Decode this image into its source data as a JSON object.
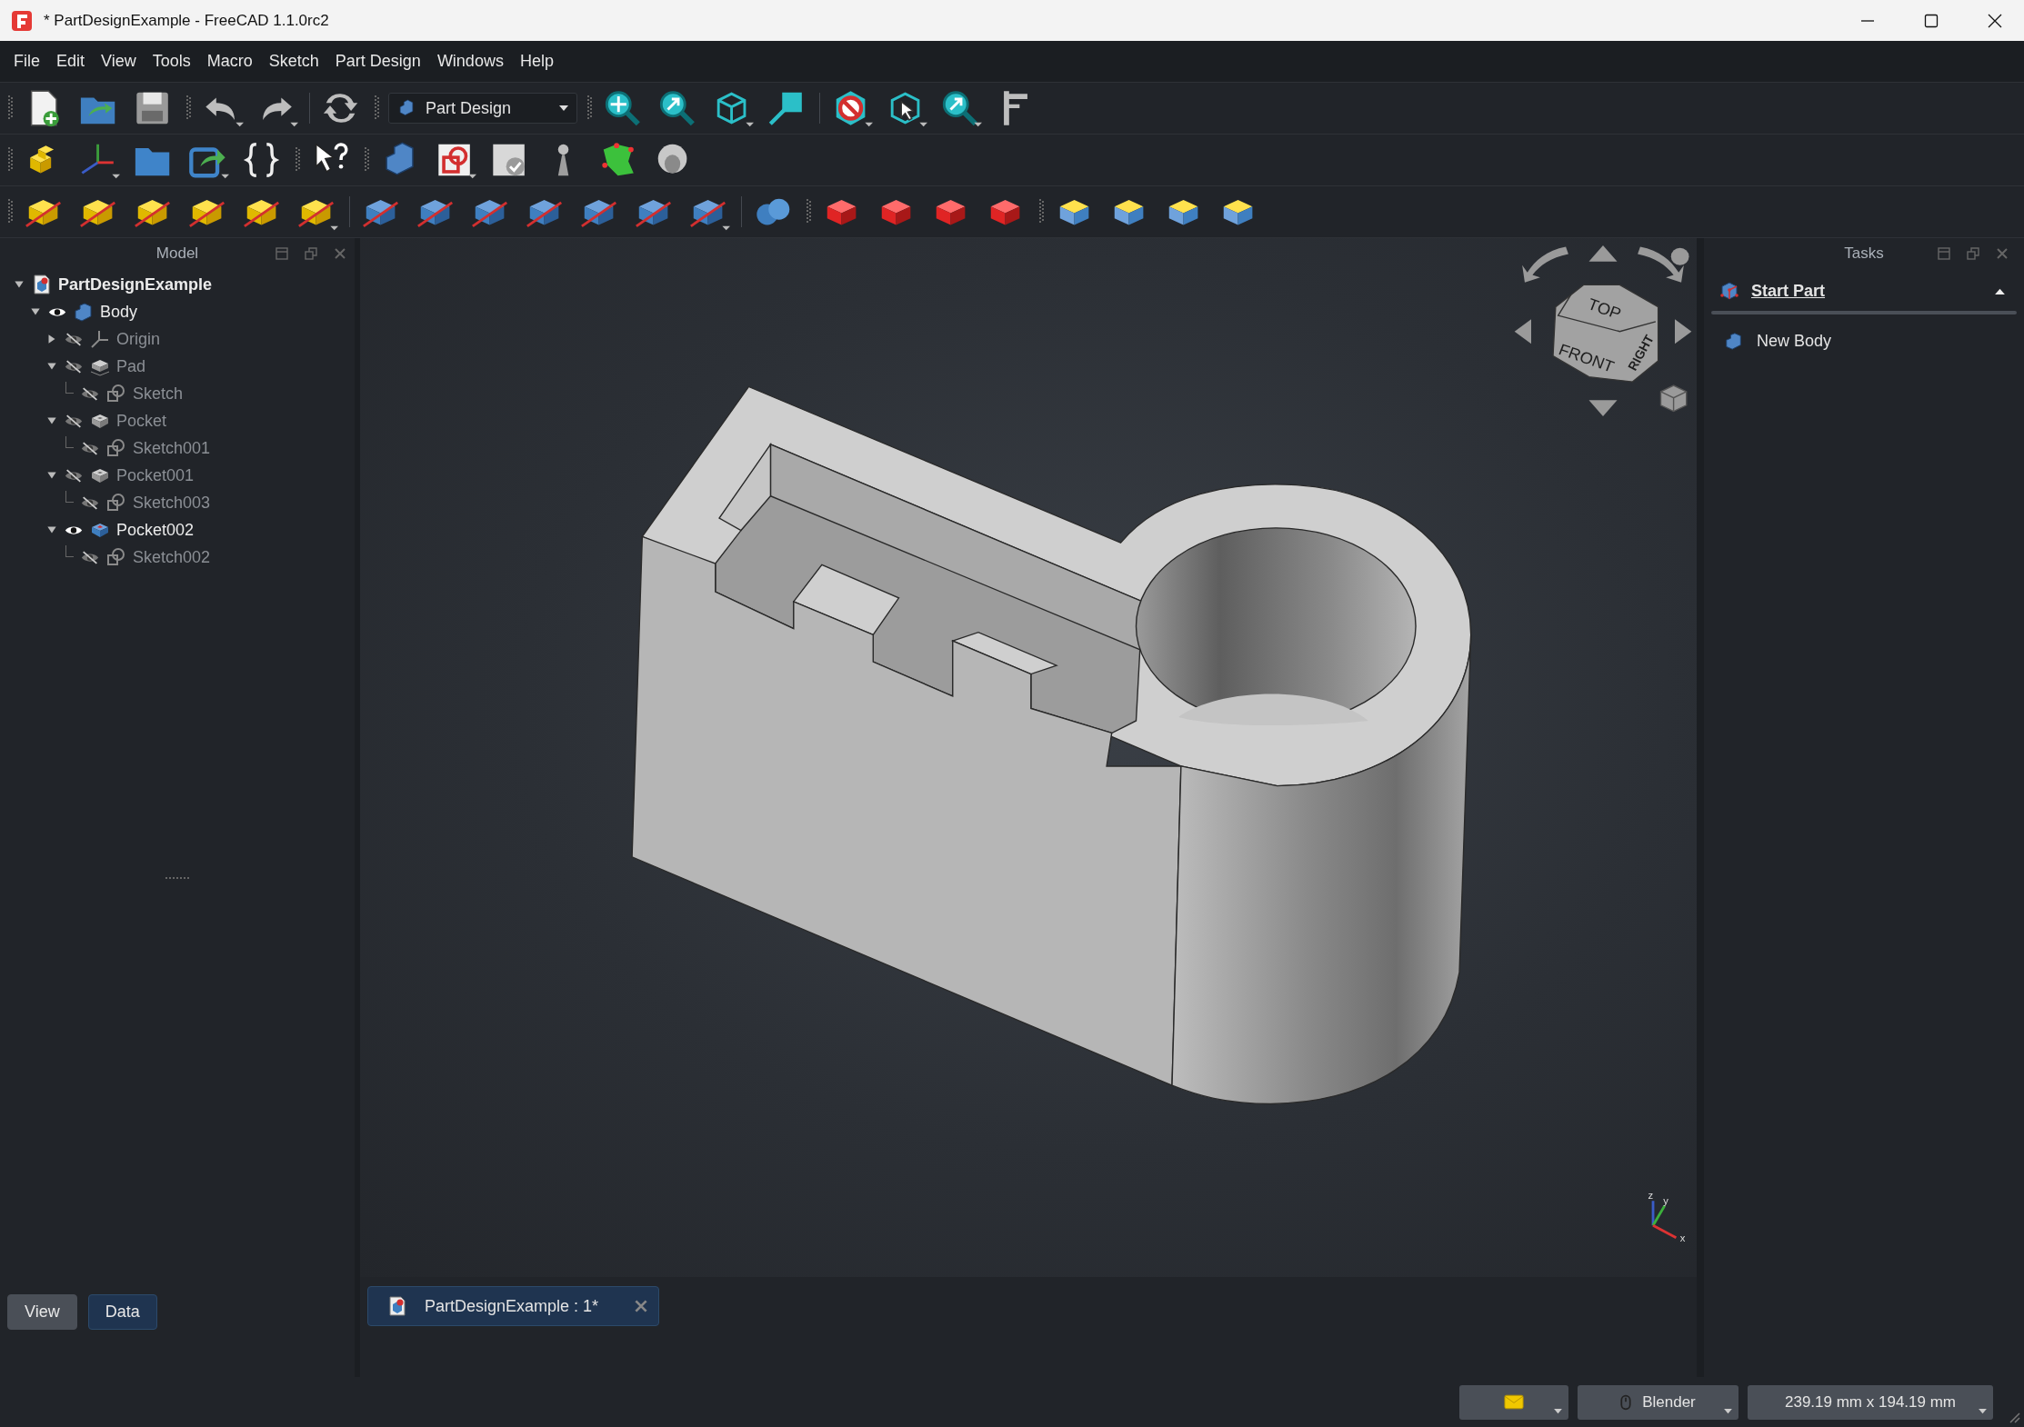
{
  "window": {
    "title": "* PartDesignExample - FreeCAD 1.1.0rc2"
  },
  "menu": [
    {
      "label": "File"
    },
    {
      "label": "Edit"
    },
    {
      "label": "View"
    },
    {
      "label": "Tools"
    },
    {
      "label": "Macro"
    },
    {
      "label": "Sketch"
    },
    {
      "label": "Part Design"
    },
    {
      "label": "Windows"
    },
    {
      "label": "Help"
    }
  ],
  "toolbar": {
    "workbench": "Part Design"
  },
  "model_panel": {
    "title": "Model",
    "tree": [
      {
        "label": "PartDesignExample",
        "kind": "document",
        "expanded": true,
        "children": [
          {
            "label": "Body",
            "kind": "body",
            "visible": true,
            "expanded": true,
            "children": [
              {
                "label": "Origin",
                "kind": "origin",
                "visible": false,
                "expanded": false
              },
              {
                "label": "Pad",
                "kind": "pad",
                "visible": false,
                "expanded": true,
                "children": [
                  {
                    "label": "Sketch",
                    "kind": "sketch",
                    "visible": false
                  }
                ]
              },
              {
                "label": "Pocket",
                "kind": "pocket",
                "visible": false,
                "expanded": true,
                "children": [
                  {
                    "label": "Sketch001",
                    "kind": "sketch",
                    "visible": false
                  }
                ]
              },
              {
                "label": "Pocket001",
                "kind": "pocket",
                "visible": false,
                "expanded": true,
                "children": [
                  {
                    "label": "Sketch003",
                    "kind": "sketch",
                    "visible": false
                  }
                ]
              },
              {
                "label": "Pocket002",
                "kind": "pocket",
                "visible": true,
                "expanded": true,
                "children": [
                  {
                    "label": "Sketch002",
                    "kind": "sketch",
                    "visible": false
                  }
                ]
              }
            ]
          }
        ]
      }
    ]
  },
  "property_tabs": [
    {
      "label": "View",
      "selected": true
    },
    {
      "label": "Data",
      "selected": false
    }
  ],
  "nav_cube": {
    "faces": [
      "TOP",
      "FRONT",
      "RIGHT"
    ]
  },
  "axis_labels": [
    "z",
    "y",
    "x"
  ],
  "document_tabs": [
    {
      "label": "PartDesignExample : 1*",
      "selected": true
    }
  ],
  "tasks_panel": {
    "title": "Tasks",
    "section": {
      "title": "Start Part",
      "expanded": true,
      "items": [
        {
          "label": "New Body"
        }
      ]
    }
  },
  "status_bar": {
    "navigation_style": "Blender",
    "dimensions": "239.19 mm x 194.19 mm"
  }
}
